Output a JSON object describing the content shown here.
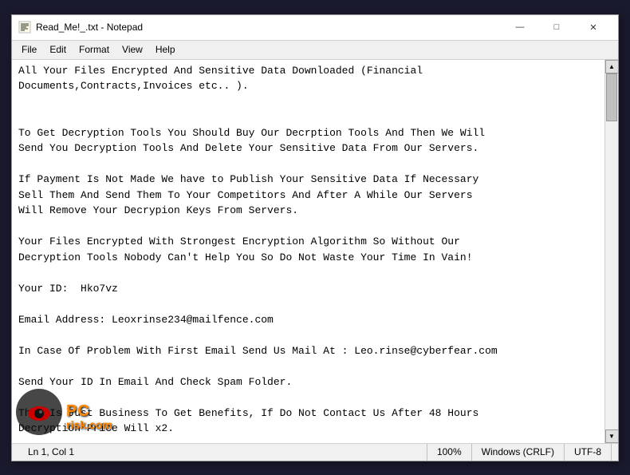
{
  "window": {
    "title": "Read_Me!_.txt - Notepad",
    "icon": "notepad"
  },
  "titlebar": {
    "minimize_label": "—",
    "maximize_label": "□",
    "close_label": "✕"
  },
  "menubar": {
    "items": [
      "File",
      "Edit",
      "Format",
      "View",
      "Help"
    ]
  },
  "content": {
    "text": "All Your Files Encrypted And Sensitive Data Downloaded (Financial\nDocuments,Contracts,Invoices etc.. ).\n\n\nTo Get Decryption Tools You Should Buy Our Decrption Tools And Then We Will\nSend You Decryption Tools And Delete Your Sensitive Data From Our Servers.\n\nIf Payment Is Not Made We have to Publish Your Sensitive Data If Necessary\nSell Them And Send Them To Your Competitors And After A While Our Servers\nWill Remove Your Decrypion Keys From Servers.\n\nYour Files Encrypted With Strongest Encryption Algorithm So Without Our\nDecryption Tools Nobody Can't Help You So Do Not Waste Your Time In Vain!\n\nYour ID:  Hko7vz\n\nEmail Address: Leoxrinse234@mailfence.com\n\nIn Case Of Problem With First Email Send Us Mail At : Leo.rinse@cyberfear.com\n\nSend Your ID In Email And Check Spam Folder.\n\nThis Is Just Business To Get Benefits, If Do Not Contact Us After 48 Hours\nDecryption Price Will x2."
  },
  "statusbar": {
    "position": "Ln 1, Col 1",
    "zoom": "100%",
    "line_ending": "Windows (CRLF)",
    "encoding": "UTF-8"
  },
  "watermark": {
    "site": "PC",
    "domain": "risk.com"
  }
}
